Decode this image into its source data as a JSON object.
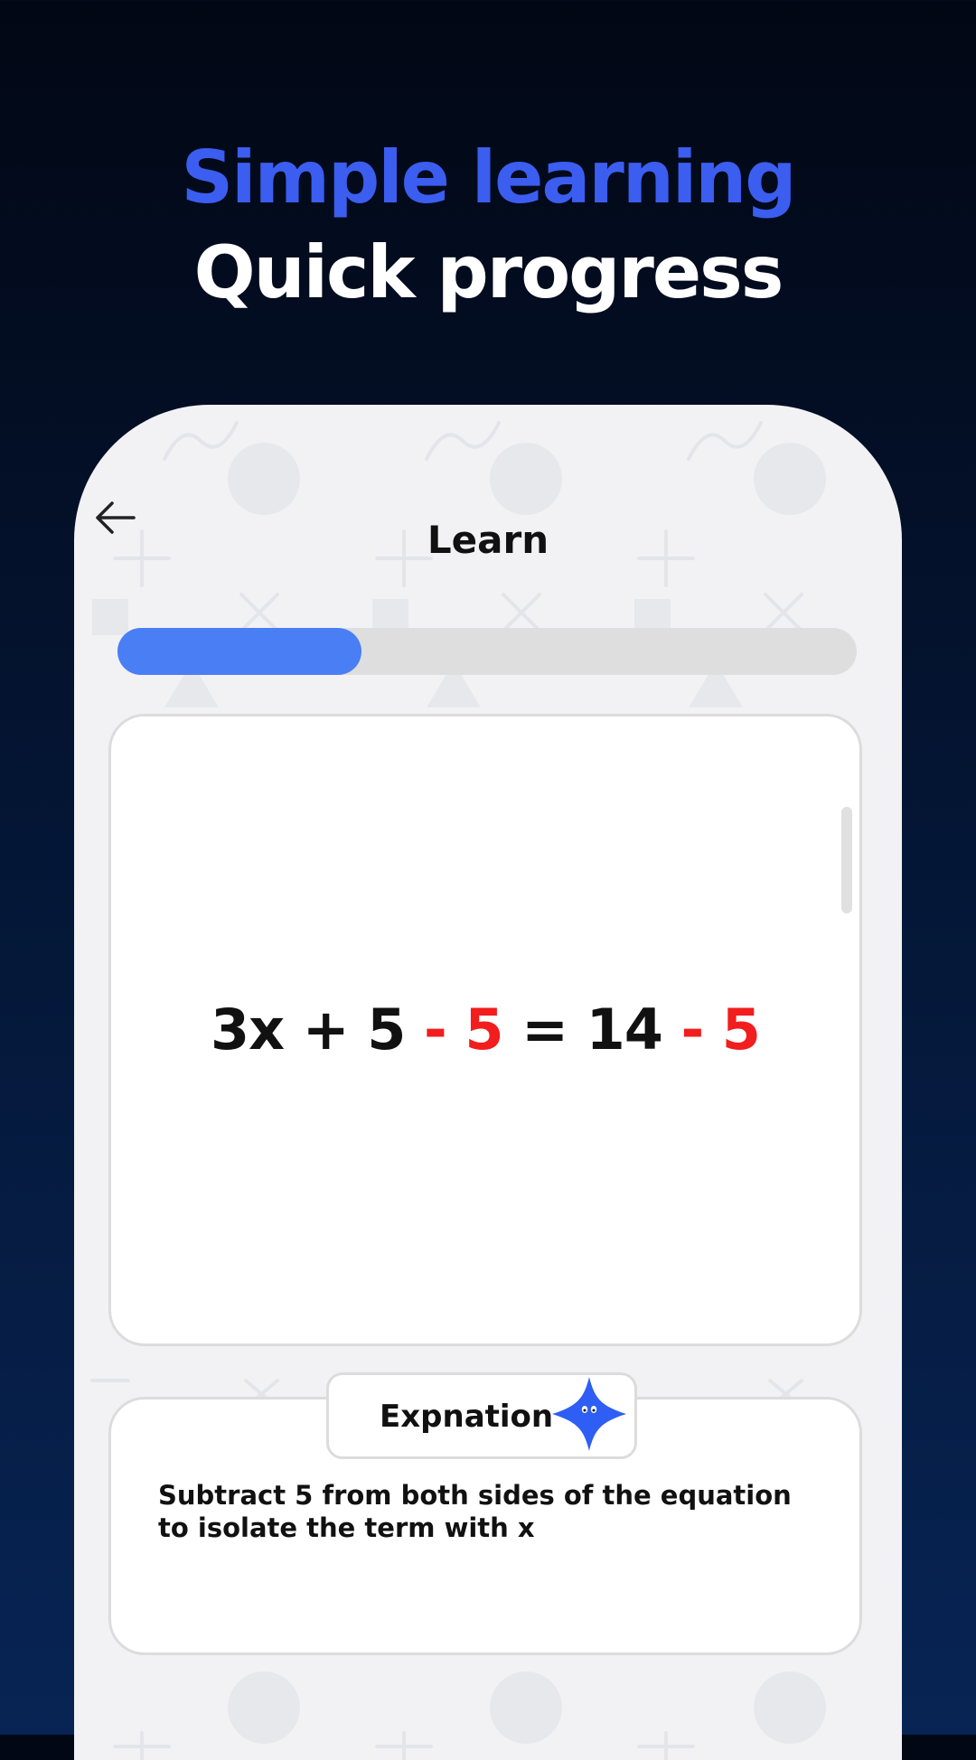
{
  "headline": {
    "line1": "Simple learning",
    "line2": "Quick progress"
  },
  "screen": {
    "title": "Learn",
    "back_icon": "arrow-left-icon",
    "progress": 0.33
  },
  "problem": {
    "parts": [
      "3x + 5",
      " - 5",
      " = 14",
      " - 5"
    ]
  },
  "explanation": {
    "label": "Expnation",
    "mascot_icon": "star-mascot-icon",
    "text": "Subtract 5 from both sides of the equation to isolate the term with x"
  },
  "colors": {
    "accent_blue": "#3b5ef0",
    "progress_blue": "#4a7ef4",
    "highlight_red": "#f21d1d"
  }
}
